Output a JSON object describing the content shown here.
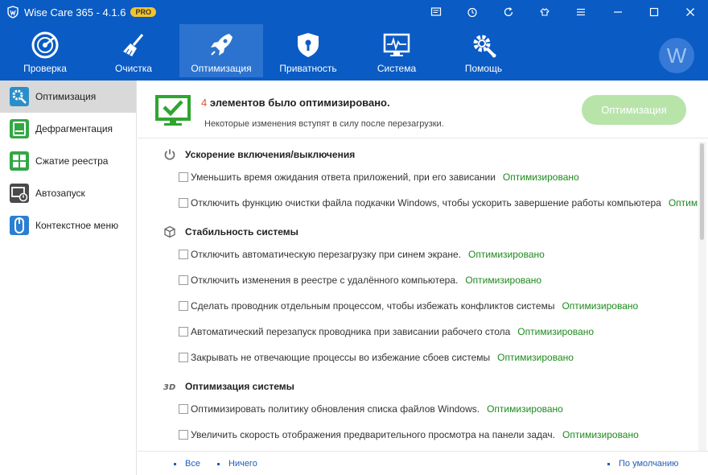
{
  "window": {
    "title": "Wise Care 365 - 4.1.6",
    "badge": "PRO"
  },
  "titlebar_icons": [
    "message-icon",
    "timer-icon",
    "refresh-icon",
    "skin-icon",
    "menu-icon",
    "minimize-icon",
    "maximize-icon",
    "close-icon"
  ],
  "nav": {
    "items": [
      {
        "label": "Проверка",
        "icon": "radar-icon"
      },
      {
        "label": "Очистка",
        "icon": "broom-icon"
      },
      {
        "label": "Оптимизация",
        "icon": "rocket-icon",
        "active": true
      },
      {
        "label": "Приватность",
        "icon": "shield-lock-icon"
      },
      {
        "label": "Система",
        "icon": "monitor-pulse-icon"
      },
      {
        "label": "Помощь",
        "icon": "gear-wrench-icon"
      }
    ],
    "avatar_letter": "W"
  },
  "sidebar": {
    "items": [
      {
        "label": "Оптимизация",
        "icon": "gear-icon",
        "active": true
      },
      {
        "label": "Дефрагментация",
        "icon": "disk-icon"
      },
      {
        "label": "Сжатие реестра",
        "icon": "registry-icon"
      },
      {
        "label": "Автозапуск",
        "icon": "startup-icon"
      },
      {
        "label": "Контекстное меню",
        "icon": "mouse-icon"
      }
    ]
  },
  "header": {
    "count": "4",
    "headline": " элементов было оптимизировано.",
    "subline": "Некоторые изменения вступят в силу после перезагрузки.",
    "button_label": "Оптимизация"
  },
  "sections": [
    {
      "title": "Ускорение включения/выключения",
      "icon": "power-icon",
      "items": [
        {
          "text": "Уменьшить время ожидания ответа приложений, при его зависании",
          "status": "Оптимизировано"
        },
        {
          "text": "Отключить функцию очистки файла подкачки Windows, чтобы ускорить завершение работы компьютера",
          "status": "Оптимизиро..."
        }
      ]
    },
    {
      "title": "Стабильность системы",
      "icon": "cube-icon",
      "items": [
        {
          "text": "Отключить автоматическую перезагрузку при синем экране.",
          "status": "Оптимизировано"
        },
        {
          "text": "Отключить изменения в реестре с удалённого компьютера.",
          "status": "Оптимизировано"
        },
        {
          "text": "Сделать проводник отдельным процессом, чтобы избежать конфликтов системы",
          "status": "Оптимизировано"
        },
        {
          "text": "Автоматический перезапуск проводника при зависании рабочего стола",
          "status": "Оптимизировано"
        },
        {
          "text": "Закрывать не отвечающие процессы во избежание сбоев системы",
          "status": "Оптимизировано"
        }
      ]
    },
    {
      "title": "Оптимизация системы",
      "icon": "3d-icon",
      "items": [
        {
          "text": "Оптимизировать политику обновления списка файлов Windows.",
          "status": "Оптимизировано"
        },
        {
          "text": "Увеличить скорость отображения предварительного просмотра на панели задач.",
          "status": "Оптимизировано"
        }
      ]
    }
  ],
  "footer": {
    "all": "Все",
    "none": "Ничего",
    "default": "По умолчанию"
  },
  "colors": {
    "brand_blue": "#0a5bc4",
    "active_nav": "#2c73cf",
    "status_green": "#1d8a1d",
    "count_red": "#e0522f",
    "button_green": "#b8e4aa",
    "link_blue": "#1e5fb8"
  }
}
